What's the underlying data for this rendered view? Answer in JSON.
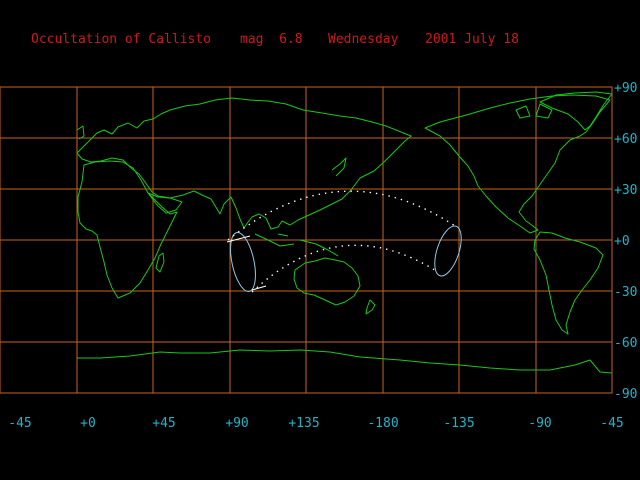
{
  "title": {
    "event": "Occultation of Callisto",
    "magnitude": "mag  6.8",
    "weekday": "Wednesday",
    "date": "2001 July 18"
  },
  "latitude_labels": [
    "+90",
    "+60",
    "+30",
    "+0",
    "-30",
    "-60",
    "-90"
  ],
  "longitude_labels": [
    "-45",
    "+0",
    "+45",
    "+90",
    "+135",
    "-180",
    "-135",
    "-90",
    "-45"
  ],
  "colors": {
    "background": "#000000",
    "title": "#d01818",
    "grid": "#c8641e",
    "coastline": "#18c818",
    "axis_labels": "#20b4c8",
    "occultation_limb": "#90c8e6",
    "path_dots": "#ffffff"
  }
}
